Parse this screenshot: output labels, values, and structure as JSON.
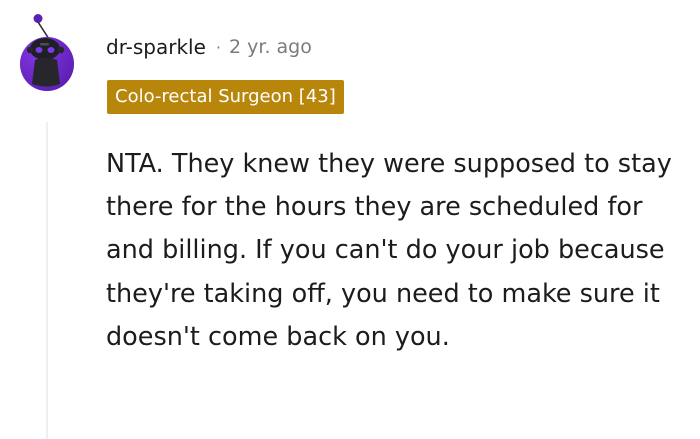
{
  "comment": {
    "author": "dr-sparkle",
    "separator": "·",
    "timestamp": "2 yr. ago",
    "flair": "Colo-rectal Surgeon [43]",
    "body": "NTA. They knew they were supposed to stay there for the hours they are scheduled for and billing. If you can't do your job because they're taking off, you need to make sure it doesn't come back on you."
  },
  "icons": {
    "avatar": "snoo-avatar-icon"
  },
  "colors": {
    "avatar_purple": "#6b2bd6",
    "flair_background": "#b8860b",
    "flair_text": "#ffffff",
    "meta_gray": "#787c7e",
    "thread_line": "#edeff1"
  }
}
